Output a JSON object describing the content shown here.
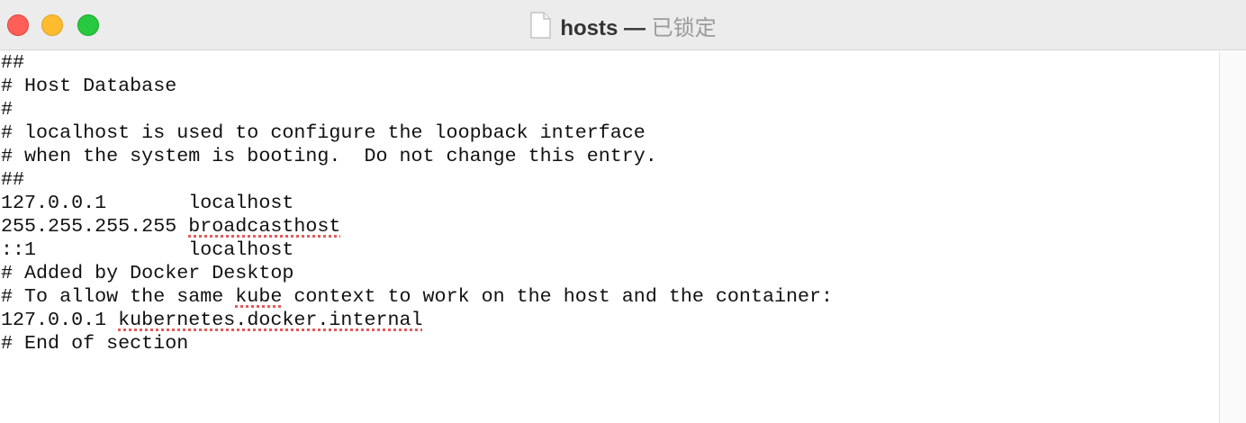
{
  "window": {
    "file_name": "hosts",
    "separator": " — ",
    "status": "已锁定"
  },
  "icons": {
    "document": "document-icon"
  },
  "colors": {
    "close": "#ff5f57",
    "minimize": "#febc2e",
    "maximize": "#28c840",
    "spellcheck": "#e45a5a"
  },
  "editor": {
    "lines": [
      {
        "text": "##"
      },
      {
        "text": "# Host Database"
      },
      {
        "text": "#"
      },
      {
        "text": "# localhost is used to configure the loopback interface"
      },
      {
        "text": "# when the system is booting.  Do not change this entry."
      },
      {
        "text": "##"
      },
      {
        "text": "127.0.0.1       localhost"
      },
      {
        "pre": "255.255.255.255 ",
        "flag": "broadcasthost",
        "post": ""
      },
      {
        "text": "::1             localhost"
      },
      {
        "text": "# Added by Docker Desktop"
      },
      {
        "pre": "# To allow the same ",
        "flag": "kube",
        "post": " context to work on the host and the container:"
      },
      {
        "pre": "127.0.0.1 ",
        "flag": "kubernetes.docker.internal",
        "post": ""
      },
      {
        "text": "# End of section"
      }
    ]
  }
}
